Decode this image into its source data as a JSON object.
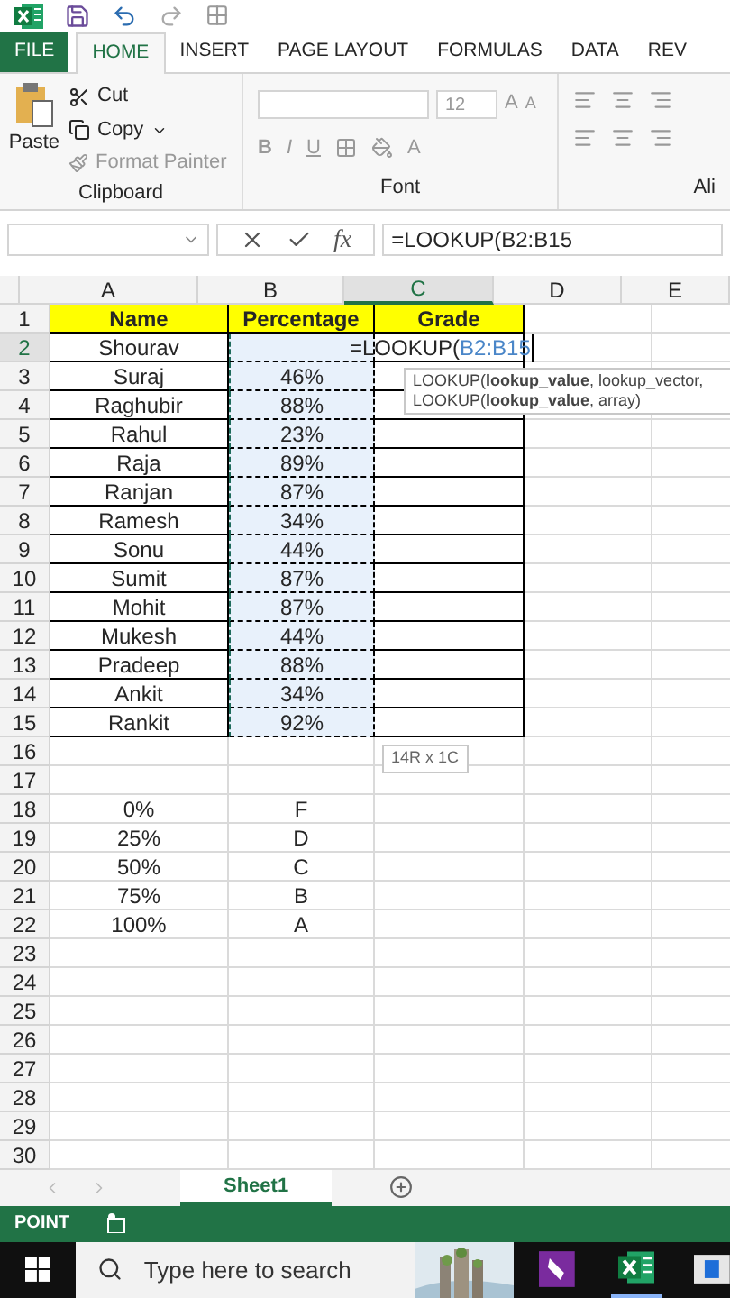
{
  "ribbon_tabs": [
    {
      "label": "FILE",
      "kind": "file",
      "selected": false
    },
    {
      "label": "HOME",
      "kind": "tab",
      "selected": true
    },
    {
      "label": "INSERT",
      "kind": "tab",
      "selected": false
    },
    {
      "label": "PAGE LAYOUT",
      "kind": "tab",
      "selected": false
    },
    {
      "label": "FORMULAS",
      "kind": "tab",
      "selected": false
    },
    {
      "label": "DATA",
      "kind": "tab",
      "selected": false
    },
    {
      "label": "REV",
      "kind": "tab",
      "selected": false
    }
  ],
  "clipboard": {
    "paste": "Paste",
    "cut": "Cut",
    "copy": "Copy",
    "format_painter": "Format Painter",
    "group": "Clipboard"
  },
  "font": {
    "size": "12",
    "grow": "A",
    "shrink": "A",
    "bold": "B",
    "italic": "I",
    "underline": "U",
    "font_color": "A",
    "group": "Font"
  },
  "alignment": {
    "group": "Ali"
  },
  "formula_bar": {
    "function_label": "fx",
    "value": "=LOOKUP(B2:B15"
  },
  "columns": [
    {
      "label": "A",
      "selected": false
    },
    {
      "label": "B",
      "selected": false
    },
    {
      "label": "C",
      "selected": true
    },
    {
      "label": "D",
      "selected": false
    },
    {
      "label": "E",
      "selected": false
    }
  ],
  "rows": [
    {
      "number": "1",
      "kind": "header",
      "selected": false,
      "marked": false,
      "cells": {
        "A": "Name",
        "B": "Percentage",
        "C": "Grade"
      }
    },
    {
      "number": "2",
      "kind": "table",
      "selected": true,
      "marked": true,
      "cells": {
        "A": "Shourav"
      }
    },
    {
      "number": "3",
      "kind": "table",
      "selected": false,
      "marked": true,
      "cells": {
        "A": "Suraj",
        "B": "46%"
      }
    },
    {
      "number": "4",
      "kind": "table",
      "selected": false,
      "marked": true,
      "cells": {
        "A": "Raghubir",
        "B": "88%"
      }
    },
    {
      "number": "5",
      "kind": "table",
      "selected": false,
      "marked": true,
      "cells": {
        "A": "Rahul",
        "B": "23%"
      }
    },
    {
      "number": "6",
      "kind": "table",
      "selected": false,
      "marked": true,
      "cells": {
        "A": "Raja",
        "B": "89%"
      }
    },
    {
      "number": "7",
      "kind": "table",
      "selected": false,
      "marked": true,
      "cells": {
        "A": "Ranjan",
        "B": "87%"
      }
    },
    {
      "number": "8",
      "kind": "table",
      "selected": false,
      "marked": true,
      "cells": {
        "A": "Ramesh",
        "B": "34%"
      }
    },
    {
      "number": "9",
      "kind": "table",
      "selected": false,
      "marked": true,
      "cells": {
        "A": "Sonu",
        "B": "44%"
      }
    },
    {
      "number": "10",
      "kind": "table",
      "selected": false,
      "marked": true,
      "cells": {
        "A": "Sumit",
        "B": "87%"
      }
    },
    {
      "number": "11",
      "kind": "table",
      "selected": false,
      "marked": true,
      "cells": {
        "A": "Mohit",
        "B": "87%"
      }
    },
    {
      "number": "12",
      "kind": "table",
      "selected": false,
      "marked": true,
      "cells": {
        "A": "Mukesh",
        "B": "44%"
      }
    },
    {
      "number": "13",
      "kind": "table",
      "selected": false,
      "marked": true,
      "cells": {
        "A": "Pradeep",
        "B": "88%"
      }
    },
    {
      "number": "14",
      "kind": "table",
      "selected": false,
      "marked": true,
      "cells": {
        "A": "Ankit",
        "B": "34%"
      }
    },
    {
      "number": "15",
      "kind": "table",
      "selected": false,
      "marked": true,
      "cells": {
        "A": "Rankit",
        "B": "92%"
      }
    },
    {
      "number": "16",
      "kind": "plain",
      "selected": false,
      "marked": false,
      "cells": {}
    },
    {
      "number": "17",
      "kind": "plain",
      "selected": false,
      "marked": false,
      "cells": {}
    },
    {
      "number": "18",
      "kind": "plain",
      "selected": false,
      "marked": false,
      "cells": {
        "A": "0%",
        "B": "F"
      }
    },
    {
      "number": "19",
      "kind": "plain",
      "selected": false,
      "marked": false,
      "cells": {
        "A": "25%",
        "B": "D"
      }
    },
    {
      "number": "20",
      "kind": "plain",
      "selected": false,
      "marked": false,
      "cells": {
        "A": "50%",
        "B": "C"
      }
    },
    {
      "number": "21",
      "kind": "plain",
      "selected": false,
      "marked": false,
      "cells": {
        "A": "75%",
        "B": "B"
      }
    },
    {
      "number": "22",
      "kind": "plain",
      "selected": false,
      "marked": false,
      "cells": {
        "A": "100%",
        "B": "A"
      }
    },
    {
      "number": "23",
      "kind": "plain",
      "selected": false,
      "marked": false,
      "cells": {}
    },
    {
      "number": "24",
      "kind": "plain",
      "selected": false,
      "marked": false,
      "cells": {}
    },
    {
      "number": "25",
      "kind": "plain",
      "selected": false,
      "marked": false,
      "cells": {}
    },
    {
      "number": "26",
      "kind": "plain",
      "selected": false,
      "marked": false,
      "cells": {}
    },
    {
      "number": "27",
      "kind": "plain",
      "selected": false,
      "marked": false,
      "cells": {}
    },
    {
      "number": "28",
      "kind": "plain",
      "selected": false,
      "marked": false,
      "cells": {}
    },
    {
      "number": "29",
      "kind": "plain",
      "selected": false,
      "marked": false,
      "cells": {}
    },
    {
      "number": "30",
      "kind": "plain",
      "selected": false,
      "marked": false,
      "cells": {}
    }
  ],
  "cell_editor": {
    "prefix": "=LOOKUP(",
    "reference": "B2:B15"
  },
  "tooltip": {
    "lines": [
      "LOOKUP(**lookup_value**, lookup_vector,",
      "LOOKUP(**lookup_value**, array)"
    ]
  },
  "selection_size": "14R x 1C",
  "sheet_tabs": [
    {
      "label": "Sheet1",
      "selected": true
    }
  ],
  "status": "POINT",
  "search": {
    "placeholder": "Type here to search"
  }
}
